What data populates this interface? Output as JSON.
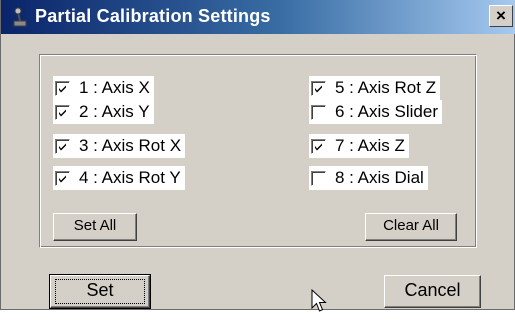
{
  "window": {
    "title": "Partial Calibration Settings",
    "close_label": "×",
    "title_icon": "joystick-icon"
  },
  "axes": {
    "left": [
      {
        "label": "1 : Axis X",
        "checked": true
      },
      {
        "label": "2 : Axis Y",
        "checked": true
      },
      {
        "label": "3 : Axis Rot X",
        "checked": true
      },
      {
        "label": "4 : Axis Rot Y",
        "checked": true
      }
    ],
    "right": [
      {
        "label": "5 : Axis Rot Z",
        "checked": true
      },
      {
        "label": "6 : Axis Slider",
        "checked": false
      },
      {
        "label": "7 : Axis Z",
        "checked": true
      },
      {
        "label": "8 : Axis Dial",
        "checked": false
      }
    ]
  },
  "group_buttons": {
    "set_all": "Set All",
    "clear_all": "Clear All"
  },
  "footer_buttons": {
    "set": "Set",
    "cancel": "Cancel"
  },
  "colors": {
    "face": "#d4d0c8",
    "title_start": "#0a246a",
    "title_end": "#a6caf0"
  }
}
